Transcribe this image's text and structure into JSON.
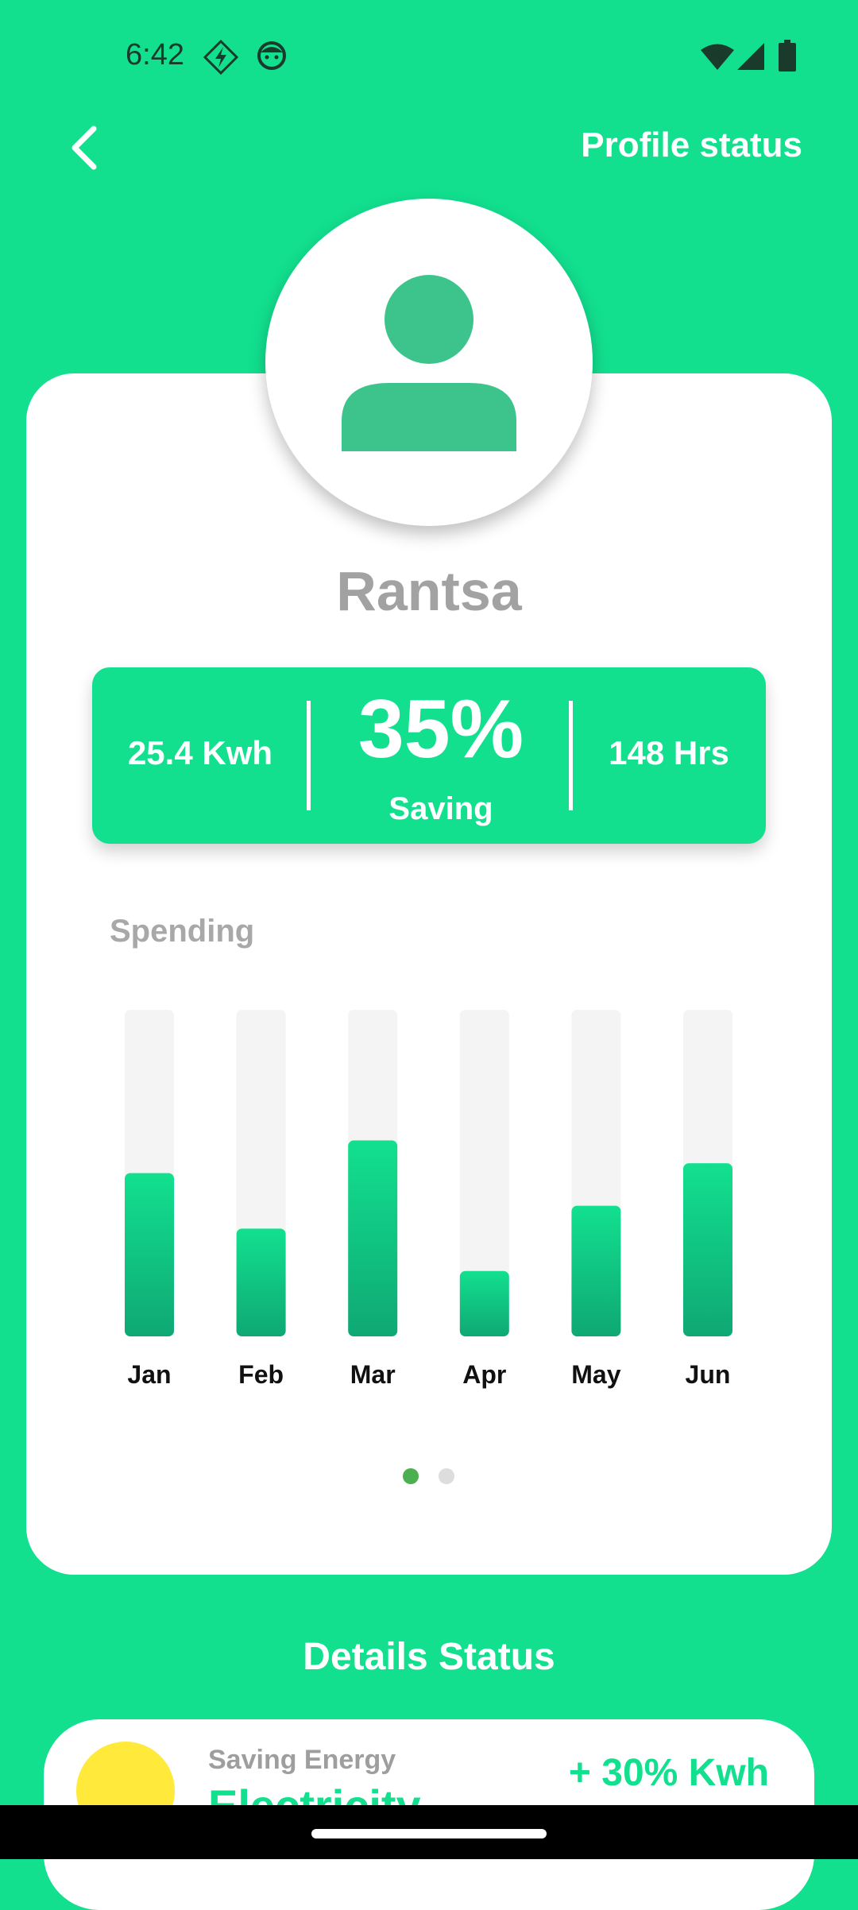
{
  "status_bar": {
    "time": "6:42",
    "left_icons": [
      "bolt-icon",
      "face-icon"
    ],
    "right_icons": [
      "wifi-icon",
      "signal-icon",
      "battery-icon"
    ]
  },
  "app_bar": {
    "back_icon": "chevron-left-icon",
    "title": "Profile status"
  },
  "profile": {
    "avatar_icon": "person-icon",
    "name": "Rantsa"
  },
  "stats": {
    "energy": "25.4 Kwh",
    "saving_percent": "35%",
    "saving_label": "Saving",
    "hours": "148 Hrs"
  },
  "spending": {
    "title": "Spending"
  },
  "chart_data": {
    "type": "bar",
    "categories": [
      "Jan",
      "Feb",
      "Mar",
      "Apr",
      "May",
      "Jun"
    ],
    "values": [
      50,
      33,
      60,
      20,
      40,
      53
    ],
    "ylim": [
      0,
      100
    ],
    "grid": false,
    "legend": "none",
    "colors": {
      "bar_top": "#12e08f",
      "bar_bottom": "#0fa874",
      "track": "#f4f4f4",
      "label": "#111111"
    }
  },
  "pager": {
    "count": 2,
    "active_index": 0,
    "active_color": "#4caf50",
    "inactive_color": "#dddddd"
  },
  "details": {
    "title": "Details Status",
    "item": {
      "subtitle": "Saving Energy",
      "title": "Electricity",
      "value": "+ 30% Kwh",
      "icon": "sun-icon"
    }
  },
  "colors": {
    "accent": "#12e08f",
    "avatar": "#3cc48c",
    "name": "#a2a2a2"
  }
}
